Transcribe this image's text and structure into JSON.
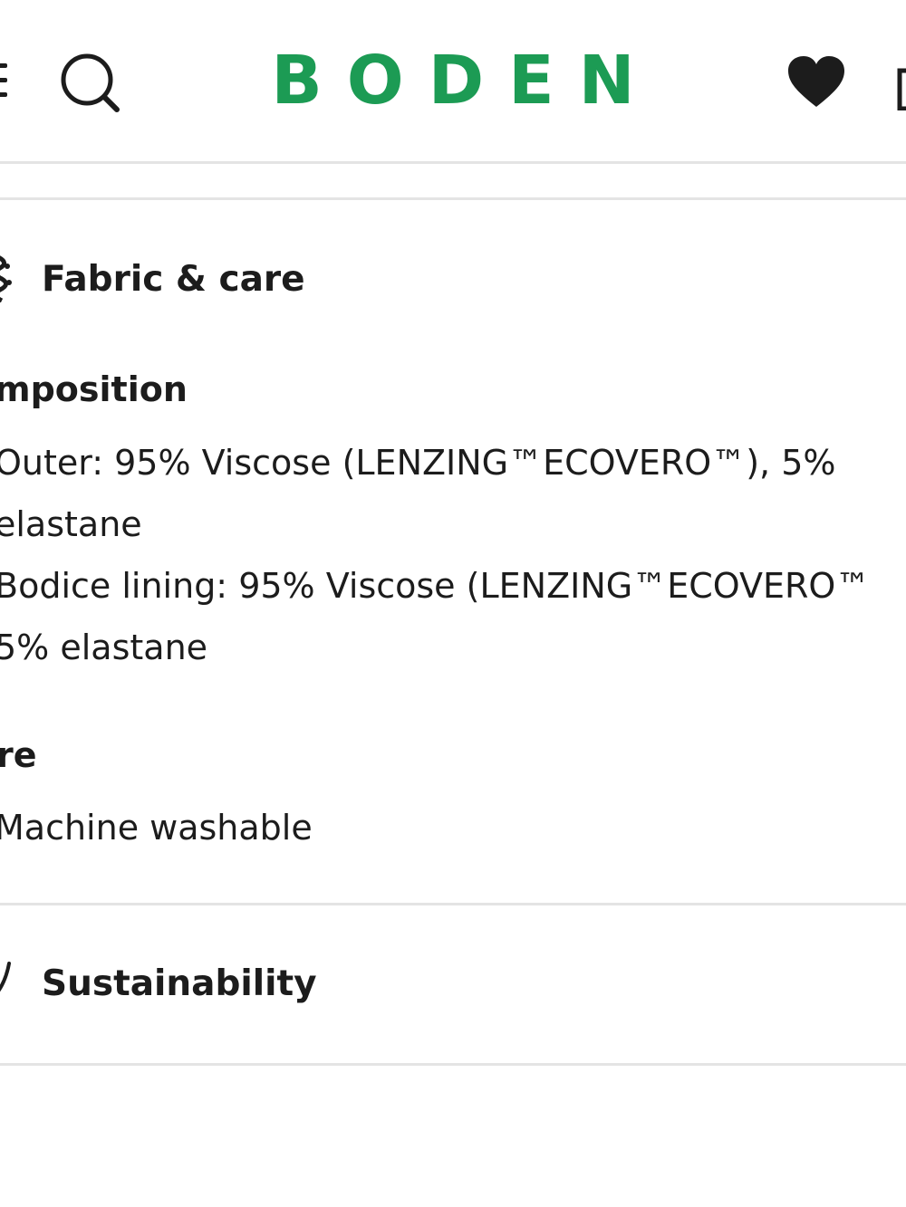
{
  "header": {
    "logo": "BODEN",
    "brand_color": "#1c9b54",
    "icons": [
      "menu-icon",
      "search-icon",
      "heart-icon",
      "bag-icon"
    ]
  },
  "fabric_care": {
    "title": "Fabric & care",
    "composition_heading": "mposition",
    "composition_lines": [
      "Outer: 95% Viscose (LENZING™ECOVERO™), 5%",
      "elastane",
      "Bodice lining: 95% Viscose (LENZING™ECOVERO™",
      "5% elastane"
    ],
    "care_heading": "re",
    "care_lines": [
      "Machine washable"
    ]
  },
  "sustainability": {
    "title": "Sustainability"
  }
}
